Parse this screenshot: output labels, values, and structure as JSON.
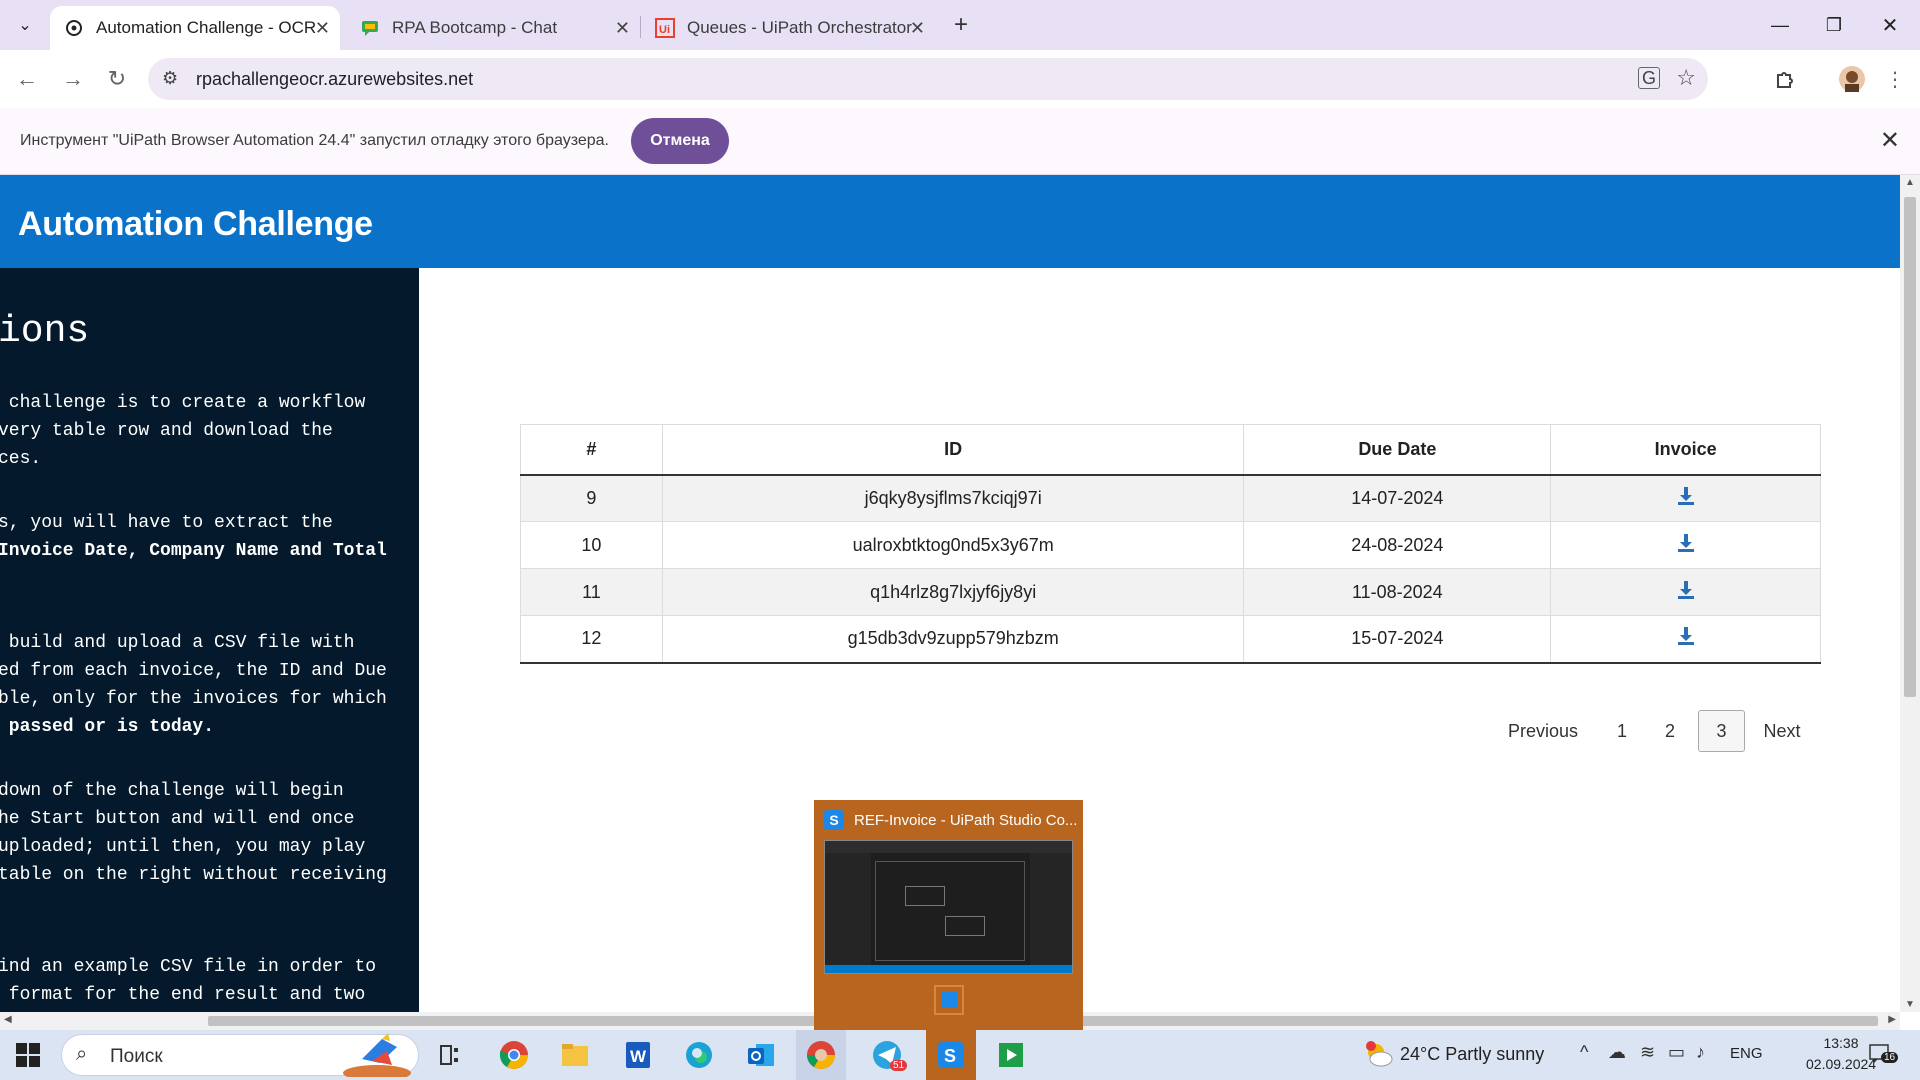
{
  "browser": {
    "tabs": [
      {
        "title": "Automation Challenge - OCR",
        "active": true
      },
      {
        "title": "RPA Bootcamp - Chat",
        "active": false
      },
      {
        "title": "Queues - UiPath Orchestrator",
        "active": false
      }
    ],
    "url": "rpachallengeocr.azurewebsites.net"
  },
  "infobar": {
    "message": "Инструмент \"UiPath Browser Automation 24.4\" запустил отладку этого браузера.",
    "cancel_label": "Отмена"
  },
  "page": {
    "brand": "Automation Challenge",
    "sidebar": {
      "heading": "ions",
      "lines": [
        " challenge is to create a workflow",
        "very table row and download the",
        "ces.",
        "s, you will have to extract the",
        "Invoice Date, Company Name and Total",
        " build and upload a CSV file with",
        "ed from each invoice, the ID and Due",
        "ble, only for the invoices for which",
        " passed or is today.",
        "down of the challenge will begin",
        "he Start button and will end once",
        "uploaded; until then, you may play",
        "table on the right without receiving",
        "ind an example CSV file in order to",
        " format for the end result and two"
      ]
    },
    "table": {
      "headers": [
        "#",
        "ID",
        "Due Date",
        "Invoice"
      ],
      "rows": [
        {
          "num": "9",
          "id": "j6qky8ysjflms7kciqj97i",
          "due": "14-07-2024"
        },
        {
          "num": "10",
          "id": "ualroxbtktog0nd5x3y67m",
          "due": "24-08-2024"
        },
        {
          "num": "11",
          "id": "q1h4rlz8g7lxjyf6jy8yi",
          "due": "11-08-2024"
        },
        {
          "num": "12",
          "id": "g15db3dv9zupp579hzbzm",
          "due": "15-07-2024"
        }
      ]
    },
    "pagination": {
      "previous": "Previous",
      "pages": [
        "1",
        "2",
        "3"
      ],
      "current": "3",
      "next": "Next"
    }
  },
  "popup": {
    "title": "REF-Invoice - UiPath Studio Co..."
  },
  "taskbar": {
    "search_placeholder": "Поиск",
    "weather": "24°C  Partly sunny",
    "lang": "ENG",
    "time": "13:38",
    "date": "02.09.2024",
    "telegram_badge": "51",
    "notifications": "16"
  },
  "colors": {
    "header_blue": "#0a73c9",
    "sidebar_bg": "#041a2c",
    "infobar_button": "#6f4f98",
    "popup_bg": "#b8661f"
  }
}
